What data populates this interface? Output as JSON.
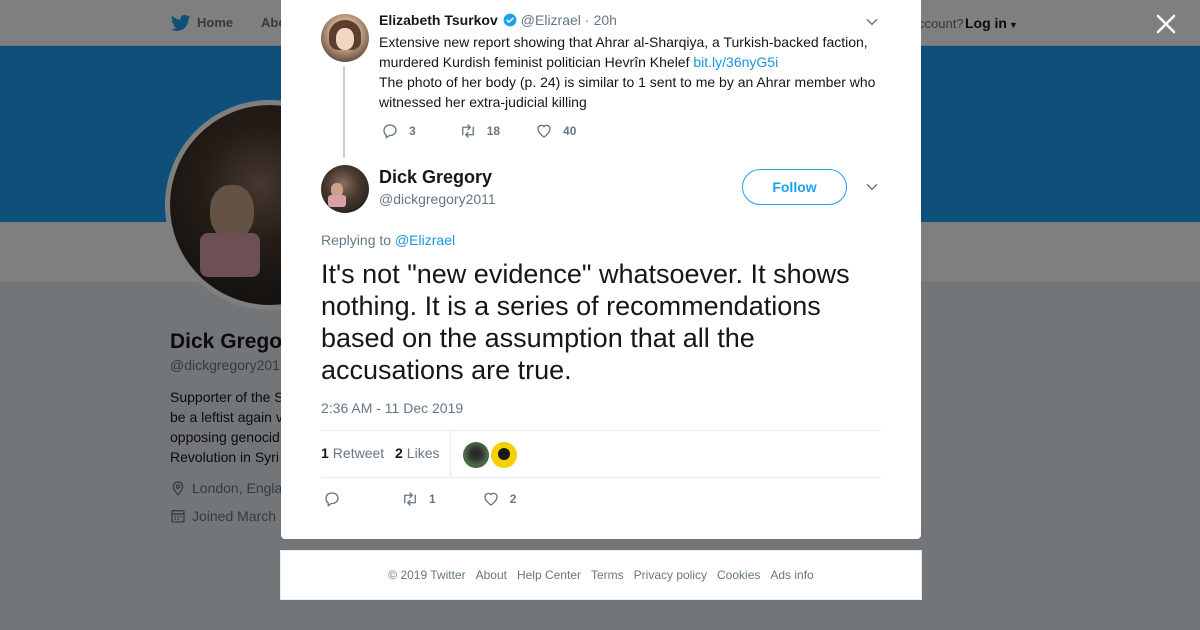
{
  "topbar": {
    "home_label": "Home",
    "about_label": "Abo",
    "have_account_text": "ccount?",
    "login_label": "Log in"
  },
  "background_profile": {
    "name": "Dick Grego",
    "handle": "@dickgregory201",
    "bio_lines": [
      "Supporter of the S",
      "be a leftist again v",
      "opposing genocid",
      "Revolution in Syri"
    ],
    "location": "London, Engla",
    "joined": "Joined March"
  },
  "context_tweet": {
    "name": "Elizabeth Tsurkov",
    "handle": "@Elizrael",
    "separator": "·",
    "time": "20h",
    "text_part1": "Extensive new report showing that Ahrar al-Sharqiya, a Turkish-backed faction, murdered Kurdish feminist politician Hevrîn Khelef",
    "link": "bit.ly/36nyG5i",
    "text_part2": "The photo of her body (p. 24) is similar to 1 sent to me by an Ahrar member who witnessed her extra-judicial killing",
    "reply_count": "3",
    "retweet_count": "18",
    "like_count": "40"
  },
  "main_tweet": {
    "name": "Dick Gregory",
    "handle": "@dickgregory2011",
    "follow_label": "Follow",
    "replying_prefix": "Replying to",
    "replying_to": "@Elizrael",
    "text": "It's not \"new evidence\" whatsoever. It shows nothing. It is a series of recommendations based on the assumption that all the accusations are true.",
    "timestamp": "2:36 AM - 11 Dec 2019",
    "retweets_num": "1",
    "retweets_label": "Retweet",
    "likes_num": "2",
    "likes_label": "Likes",
    "action_retweet_count": "1",
    "action_like_count": "2"
  },
  "footer": {
    "copyright": "© 2019 Twitter",
    "links": [
      "About",
      "Help Center",
      "Terms",
      "Privacy policy",
      "Cookies",
      "Ads info"
    ]
  },
  "colors": {
    "brand_blue": "#1da1f2",
    "link_blue": "#1b95e0",
    "secondary_text": "#657786",
    "overlay": "rgba(0,0,0,0.5)"
  },
  "icons": {
    "logo": "twitter-bird-icon",
    "close": "close-icon",
    "verified": "verified-badge-icon",
    "chevron": "chevron-down-icon",
    "reply": "reply-icon",
    "retweet": "retweet-icon",
    "like": "heart-icon",
    "location": "location-pin-icon",
    "calendar": "calendar-icon"
  }
}
